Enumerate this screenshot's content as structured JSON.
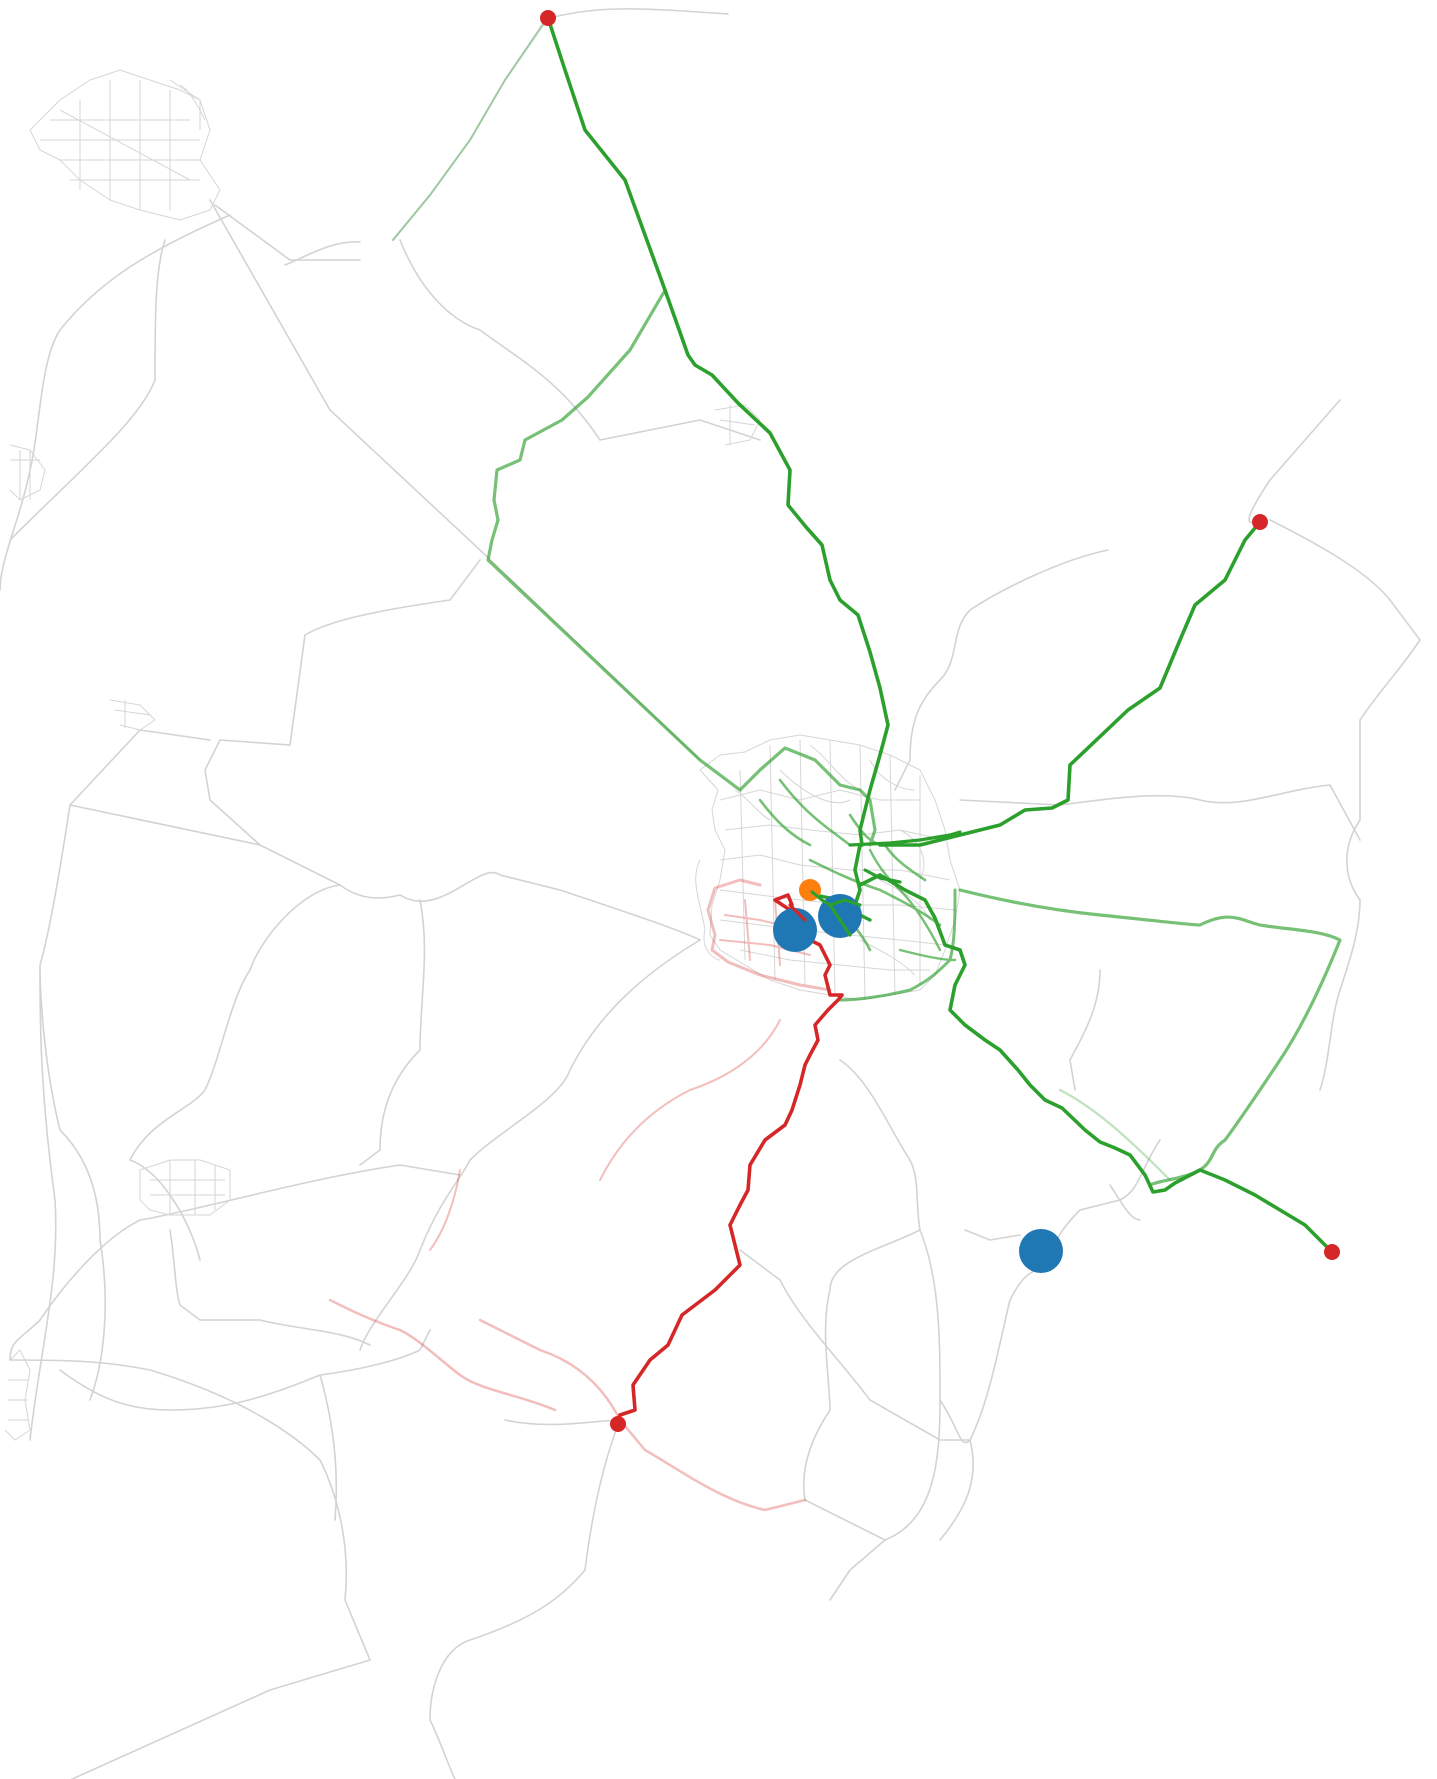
{
  "map": {
    "background": "#ffffff",
    "colors": {
      "road": "#d3d3d3",
      "route_green": "#2ca02c",
      "route_red": "#d62728",
      "endpoint": "#d62728",
      "facility": "#1f77b4",
      "origin": "#ff7f0e"
    },
    "legend": null,
    "title": ""
  }
}
